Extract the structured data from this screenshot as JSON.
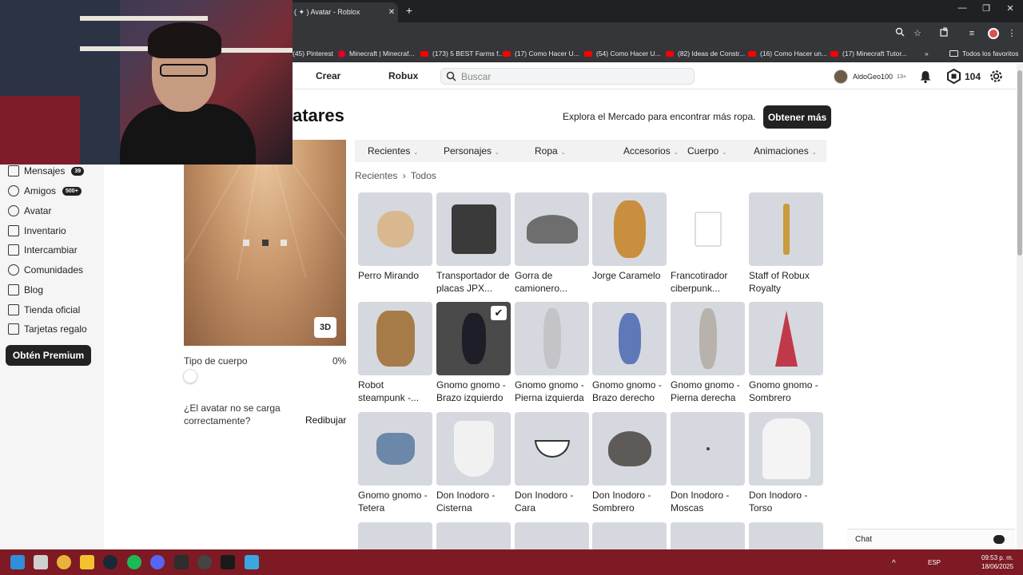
{
  "browser": {
    "tab_title": "( ✦ ) Avatar - Roblox",
    "tab_close": "✕",
    "new_tab": "+",
    "window_controls": {
      "minimize": "—",
      "restore": "❐",
      "close": "✕"
    },
    "bookmarks": [
      {
        "label": "(45) Pinterest",
        "icon": "pinterest-icon"
      },
      {
        "label": "Minecraft | Minecraf...",
        "icon": "pinterest-icon"
      },
      {
        "label": "(173) 5 BEST Farms f...",
        "icon": "youtube-icon"
      },
      {
        "label": "(17) Como Hacer U...",
        "icon": "youtube-icon"
      },
      {
        "label": "(54) Como Hacer U...",
        "icon": "youtube-icon"
      },
      {
        "label": "(82) Ideas de Constr...",
        "icon": "youtube-icon"
      },
      {
        "label": "(16) Como Hacer un...",
        "icon": "youtube-icon"
      },
      {
        "label": "(17) Minecraft Tutor...",
        "icon": "youtube-icon"
      }
    ],
    "bookmarks_more": "»",
    "all_bookmarks": "Todos los favoritos"
  },
  "topnav": {
    "create": "Crear",
    "robux": "Robux",
    "search_placeholder": "Buscar",
    "username": "AldoGeo100",
    "age_badge": "13+",
    "robux_balance": "104"
  },
  "header": {
    "title": "atares",
    "explore_text": "Explora el Mercado para encontrar más ropa.",
    "get_more": "Obtener más"
  },
  "sidebar": {
    "items": [
      {
        "label": "Mensajes",
        "badge": "39",
        "icon": "message-icon"
      },
      {
        "label": "Amigos",
        "badge": "500+",
        "icon": "friends-icon"
      },
      {
        "label": "Avatar",
        "badge": "",
        "icon": "avatar-icon"
      },
      {
        "label": "Inventario",
        "badge": "",
        "icon": "inventory-icon"
      },
      {
        "label": "Intercambiar",
        "badge": "",
        "icon": "trade-icon"
      },
      {
        "label": "Comunidades",
        "badge": "",
        "icon": "groups-icon"
      },
      {
        "label": "Blog",
        "badge": "",
        "icon": "blog-icon"
      },
      {
        "label": "Tienda oficial",
        "badge": "",
        "icon": "shop-icon"
      },
      {
        "label": "Tarjetas regalo",
        "badge": "",
        "icon": "gift-card-icon"
      }
    ],
    "premium": "Obtén Premium"
  },
  "preview": {
    "btn_3d": "3D",
    "body_type_label": "Tipo de cuerpo",
    "body_type_pct": "0%",
    "body_type_value": 0,
    "load_question": "¿El avatar no se carga correctamente?",
    "redraw": "Redibujar"
  },
  "categories": [
    "Recientes",
    "Personajes",
    "Ropa",
    "Accesorios",
    "Cuerpo",
    "Animaciones"
  ],
  "breadcrumb": {
    "parent": "Recientes",
    "sep": "›",
    "current": "Todos"
  },
  "items": [
    {
      "label": "Perro Mirando",
      "state": "normal"
    },
    {
      "label": "Transportador de placas JPX...",
      "state": "normal"
    },
    {
      "label": "Gorra de camionero...",
      "state": "normal"
    },
    {
      "label": "Jorge Caramelo",
      "state": "normal"
    },
    {
      "label": "Francotirador ciberpunk...",
      "state": "blank"
    },
    {
      "label": "Staff of Robux Royalty",
      "state": "normal"
    },
    {
      "label": "Robot steampunk -...",
      "state": "normal"
    },
    {
      "label": "Gnomo gnomo - Brazo izquierdo",
      "state": "selected"
    },
    {
      "label": "Gnomo gnomo - Pierna izquierda",
      "state": "normal"
    },
    {
      "label": "Gnomo gnomo - Brazo derecho",
      "state": "normal"
    },
    {
      "label": "Gnomo gnomo - Pierna derecha",
      "state": "normal"
    },
    {
      "label": "Gnomo gnomo - Sombrero",
      "state": "normal"
    },
    {
      "label": "Gnomo gnomo - Tetera",
      "state": "normal"
    },
    {
      "label": "Don Inodoro - Cisterna",
      "state": "normal"
    },
    {
      "label": "Don Inodoro - Cara",
      "state": "normal"
    },
    {
      "label": "Don Inodoro - Sombrero",
      "state": "normal"
    },
    {
      "label": "Don Inodoro - Moscas",
      "state": "normal"
    },
    {
      "label": "Don Inodoro - Torso",
      "state": "normal"
    }
  ],
  "check_mark": "✔",
  "chat": {
    "label": "Chat"
  },
  "taskbar": {
    "lang": "ESP",
    "time": "09:53 p. m.",
    "date": "18/06/2025"
  },
  "colors": {
    "accent_dark": "#222222",
    "taskbar": "#7d1a24",
    "tile_bg": "#d6d8df"
  }
}
